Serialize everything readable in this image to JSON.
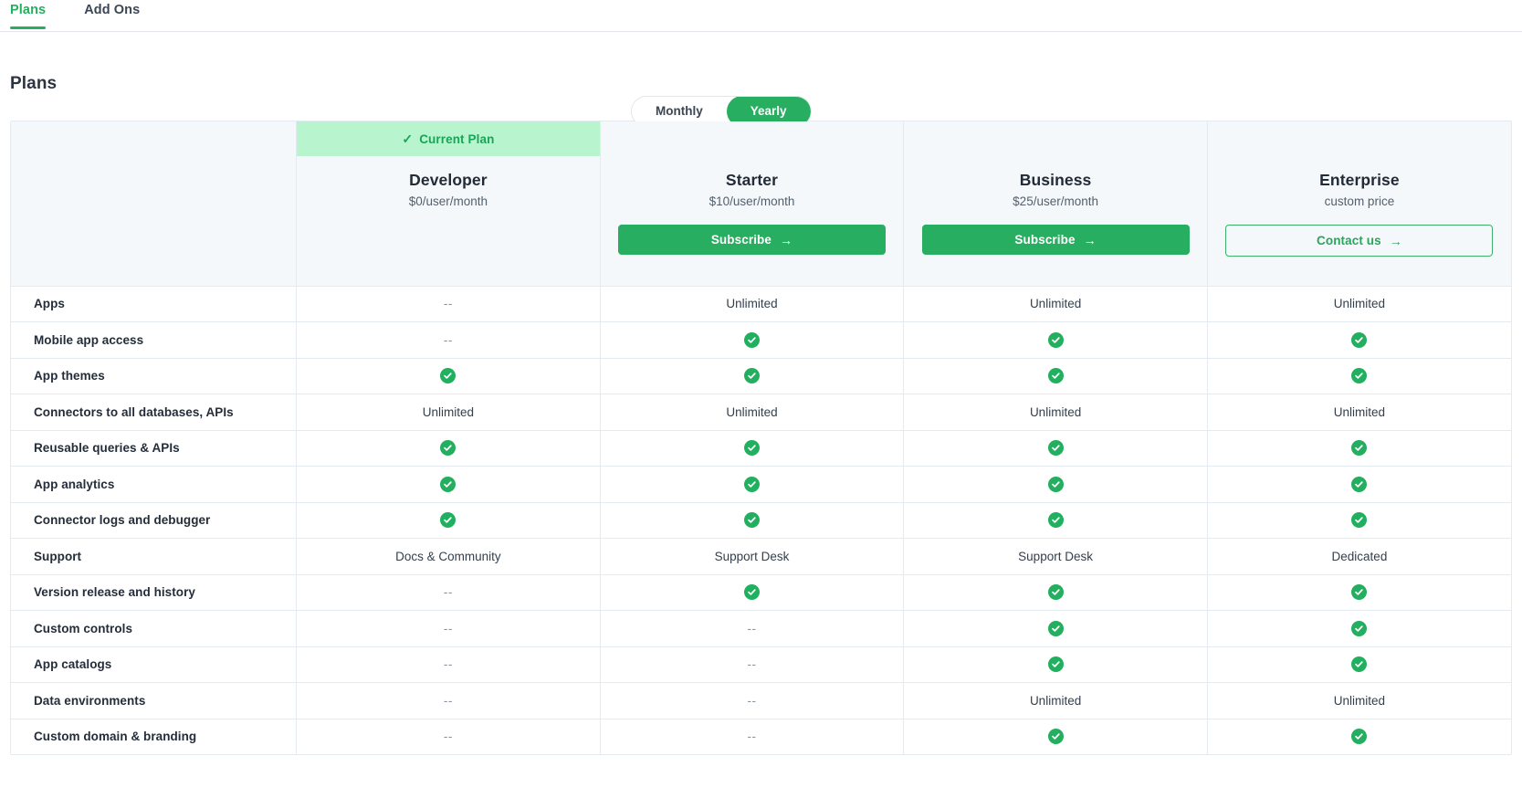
{
  "tabs": [
    {
      "label": "Plans",
      "active": true
    },
    {
      "label": "Add Ons",
      "active": false
    }
  ],
  "page": {
    "title": "Plans"
  },
  "billing_toggle": {
    "options": [
      "Monthly",
      "Yearly"
    ],
    "selected": "Yearly",
    "monthly_label": "Monthly",
    "yearly_label": "Yearly"
  },
  "colors": {
    "accent_green": "#27ae60",
    "tick_green": "#22af5f",
    "badge_bg": "#b8f5ce",
    "badge_text": "#18a558",
    "header_bg": "#f4f8fb",
    "border": "#e4eaf1"
  },
  "current_plan_badge": {
    "label": "Current Plan",
    "check_icon": "check-icon"
  },
  "plans": [
    {
      "name": "Developer",
      "price": "$0/user/month",
      "is_current": true,
      "cta": null,
      "cta_style": null
    },
    {
      "name": "Starter",
      "price": "$10/user/month",
      "is_current": false,
      "cta": "Subscribe",
      "cta_arrow": "→",
      "cta_style": "solid"
    },
    {
      "name": "Business",
      "price": "$25/user/month",
      "is_current": false,
      "cta": "Subscribe",
      "cta_arrow": "→",
      "cta_style": "solid"
    },
    {
      "name": "Enterprise",
      "price": "custom price",
      "is_current": false,
      "cta": "Contact us",
      "cta_arrow": "→",
      "cta_style": "outline"
    }
  ],
  "features": [
    {
      "label": "Apps",
      "values": [
        "--",
        "Unlimited",
        "Unlimited",
        "Unlimited"
      ]
    },
    {
      "label": "Mobile app access",
      "values": [
        "--",
        "check",
        "check",
        "check"
      ]
    },
    {
      "label": "App themes",
      "values": [
        "check",
        "check",
        "check",
        "check"
      ]
    },
    {
      "label": "Connectors to all databases, APIs",
      "values": [
        "Unlimited",
        "Unlimited",
        "Unlimited",
        "Unlimited"
      ]
    },
    {
      "label": "Reusable queries & APIs",
      "values": [
        "check",
        "check",
        "check",
        "check"
      ]
    },
    {
      "label": "App analytics",
      "values": [
        "check",
        "check",
        "check",
        "check"
      ]
    },
    {
      "label": "Connector logs and debugger",
      "values": [
        "check",
        "check",
        "check",
        "check"
      ]
    },
    {
      "label": "Support",
      "values": [
        "Docs & Community",
        "Support Desk",
        "Support Desk",
        "Dedicated"
      ]
    },
    {
      "label": "Version release and history",
      "values": [
        "--",
        "check",
        "check",
        "check"
      ]
    },
    {
      "label": "Custom controls",
      "values": [
        "--",
        "--",
        "check",
        "check"
      ]
    },
    {
      "label": "App catalogs",
      "values": [
        "--",
        "--",
        "check",
        "check"
      ]
    },
    {
      "label": "Data environments",
      "values": [
        "--",
        "--",
        "Unlimited",
        "Unlimited"
      ]
    },
    {
      "label": "Custom domain & branding",
      "values": [
        "--",
        "--",
        "check",
        "check"
      ]
    }
  ]
}
